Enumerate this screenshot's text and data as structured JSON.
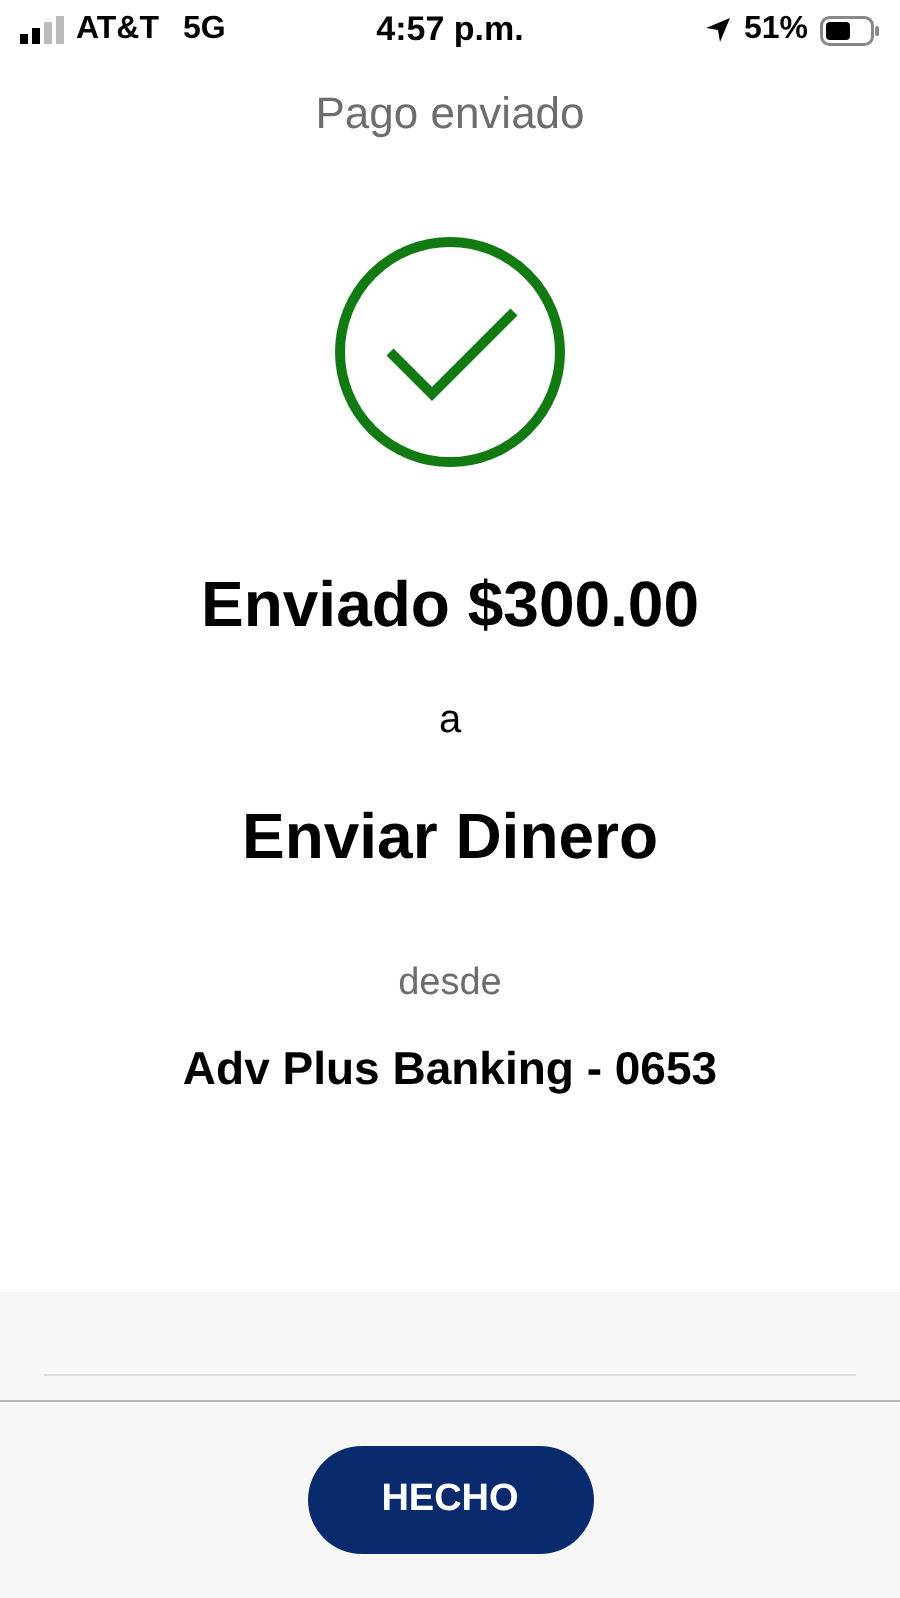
{
  "status_bar": {
    "carrier": "AT&T",
    "network": "5G",
    "time": "4:57 p.m.",
    "battery": "51%"
  },
  "title": "Pago enviado",
  "confirmation": {
    "amount_line": "Enviado $300.00",
    "to_label": "a",
    "recipient": "Enviar Dinero",
    "from_label": "desde",
    "account": "Adv Plus Banking - 0653"
  },
  "buttons": [
    "HECHO"
  ]
}
